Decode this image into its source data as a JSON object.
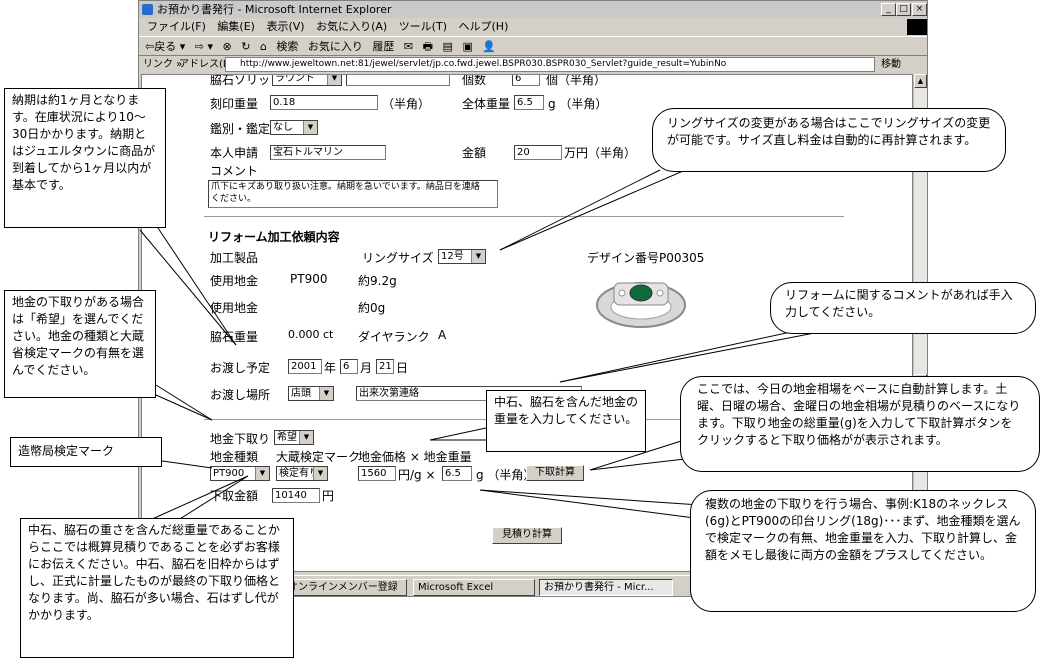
{
  "window": {
    "title": "お預かり書発行 - Microsoft Internet Explorer",
    "minimize": "_",
    "maximize": "□",
    "close": "×"
  },
  "menu": [
    "ファイル(F)",
    "編集(E)",
    "表示(V)",
    "お気に入り(A)",
    "ツール(T)",
    "ヘルプ(H)"
  ],
  "toolbar": [
    "⇦戻る ▾",
    "⇨ ▾",
    "⊗",
    "↻",
    "⌂",
    "検索",
    "お気に入り",
    "履歴",
    "✉",
    "🖶",
    "▤",
    "▣",
    "👤"
  ],
  "address": {
    "links_label": "リンク »",
    "label": "アドレス(D)",
    "url": "http://www.jeweltown.net:81/jewel/servlet/jp.co.fwd.jewel.BSPR030.BSPR030_Servlet?guide_result=YubinNo",
    "go": "移動"
  },
  "form": {
    "stone_cut_label": "脇石ソリット",
    "stone_cut_value": "ラウンド",
    "count_label": "個数",
    "count_value": "6",
    "count_unit": "個（半角）",
    "engrave_weight_label": "刻印重量",
    "engrave_weight_value": "0.18",
    "hankaku": "（半角）",
    "total_weight_label": "全体重量",
    "total_weight_value": "6.5",
    "total_weight_unit": "g （半角）",
    "appraisal_label": "鑑別・鑑定",
    "appraisal_value": "なし",
    "self_report_label": "本人申請",
    "self_report_value": "宝石トルマリン",
    "amount_label": "金額",
    "amount_value": "20",
    "amount_unit": "万円（半角）",
    "comment_label": "コメント",
    "comment_value": "爪下にキズあり取り扱い注意。納期を急いでいます。納品日を連絡ください。"
  },
  "reform": {
    "heading": "リフォーム加工依頼内容",
    "product_label": "加工製品",
    "ring_size_label": "リングサイズ",
    "ring_size_value": "12号",
    "design_no": "デザイン番号P00305",
    "metal_label": "使用地金",
    "metal_value": "PT900",
    "metal_weight": "約9.2g",
    "metal2_label": "使用地金",
    "metal2_weight": "約0g",
    "side_weight_label": "脇石重量",
    "side_weight_value": "0.000 ct",
    "diamond_rank_label": "ダイヤランク",
    "diamond_rank_value": "A",
    "delivery_date_label": "お渡し予定",
    "year": "2001",
    "year_unit": "年",
    "month": "6",
    "month_unit": "月",
    "day": "21",
    "day_unit": "日",
    "delivery_place_label": "お渡し場所",
    "delivery_place_value": "店頭",
    "delivery_note_value": "出来次第連絡"
  },
  "tradein": {
    "label": "地金下取り",
    "value": "希望",
    "metal_type_label": "地金種類",
    "mof_label": "大蔵検定マーク",
    "price_label": "地金価格 × 地金重量",
    "metal_type_value": "PT900",
    "mof_value": "検定有り",
    "price_value": "1560",
    "price_unit": "円/g ×",
    "weight_value": "6.5",
    "weight_unit": "g （半角）",
    "calc_button": "下取計算",
    "amount_label": "下取金額",
    "amount_value": "10140",
    "amount_unit": "円",
    "estimate_button": "見積り計算"
  },
  "taskbar": [
    "オンラインメンバー登録",
    "Microsoft Excel",
    "お預かり書発行 - Micr..."
  ],
  "notes": {
    "delivery": "納期は約1ヶ月となります。在庫状況により10〜30日かかります。納期とはジュエルタウンに商品が到着してから1ヶ月以内が基本です。",
    "tradein": "地金の下取りがある場合は「希望」を選んでください。地金の種類と大蔵省検定マークの有無を選んでください。",
    "mint_mark": "造幣局検定マーク",
    "total_weight": "中石、脇石の重さを含んだ総重量であることからここでは概算見積りであることを必ずお客様にお伝えください。中石、脇石を旧枠からはずし、正式に計量したものが最終の下取り価格となります。尚、脇石が多い場合、石はずし代がかかります。",
    "ring_size": "リングサイズの変更がある場合はここでリングサイズの変更が可能です。サイズ直し料金は自動的に再計算されます。",
    "reform_comment": "リフォームに関するコメントがあれば手入力してください。",
    "stone_weight": "中石、脇石を含んだ地金の重量を入力してください。",
    "auto_calc": "ここでは、今日の地金相場をベースに自動計算します。土曜、日曜の場合、金曜日の地金相場が見積りのベースになります。下取り地金の総重量(g)を入力して下取計算ボタンをクリックすると下取り価格がが表示されます。",
    "multiple": "複数の地金の下取りを行う場合、事例:K18のネックレス(6g)とPT900の印台リング(18g)･･･まず、地金種類を選んで検定マークの有無、地金重量を入力、下取り計算し、金額をメモし最後に両方の金額をプラスしてください。"
  }
}
